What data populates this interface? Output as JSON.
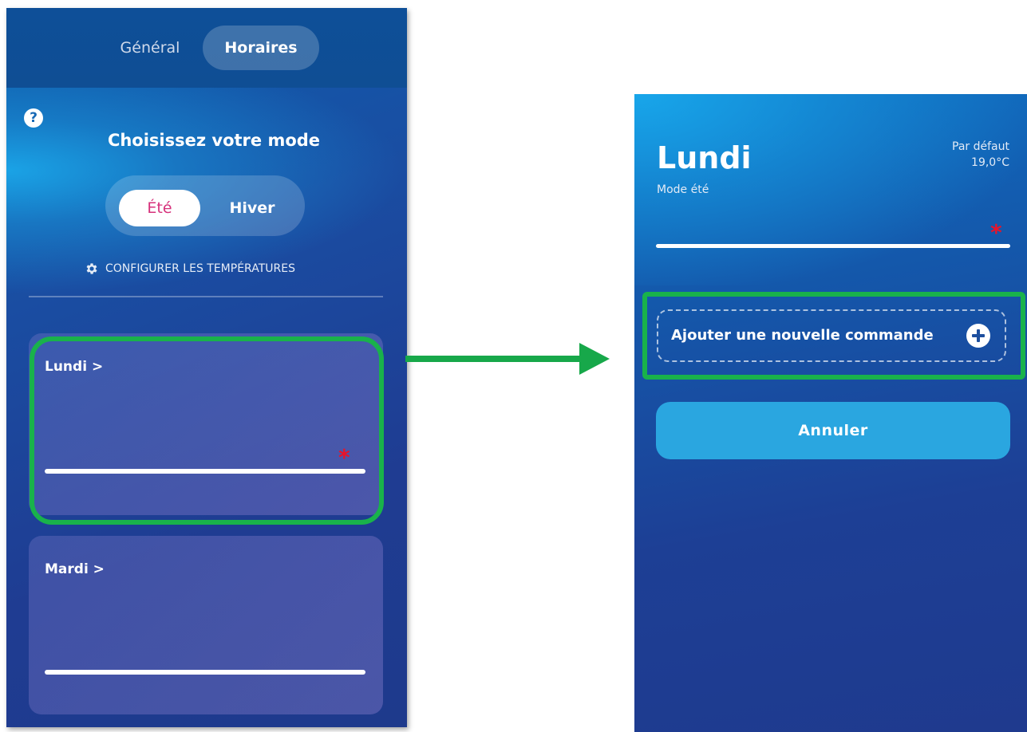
{
  "left_screen": {
    "tabs": [
      {
        "label": "Général",
        "active": false
      },
      {
        "label": "Horaires",
        "active": true
      }
    ],
    "help_icon": "?",
    "mode_title": "Choisissez votre mode",
    "mode_options": [
      {
        "label": "Été",
        "selected": true
      },
      {
        "label": "Hiver",
        "selected": false
      }
    ],
    "config_link": "CONFIGURER LES TEMPÉRATURES",
    "days": [
      {
        "label": "Lundi >",
        "required_marker": "*",
        "highlighted": true
      },
      {
        "label": "Mardi >",
        "required_marker": "",
        "highlighted": false
      }
    ]
  },
  "right_screen": {
    "day_title": "Lundi",
    "mode_label": "Mode été",
    "default_label": "Par défaut",
    "default_temperature": "19,0°C",
    "required_marker": "*",
    "add_command_label": "Ajouter une nouvelle commande",
    "cancel_label": "Annuler"
  },
  "colors": {
    "highlight_green": "#19b24b",
    "arrow_green": "#17a84a",
    "accent_pink": "#d6317b",
    "required_red": "#e8142a",
    "cancel_blue": "#2aa6e0"
  },
  "icons": [
    "help-icon",
    "gear-icon",
    "plus-icon",
    "arrow-right-icon"
  ]
}
